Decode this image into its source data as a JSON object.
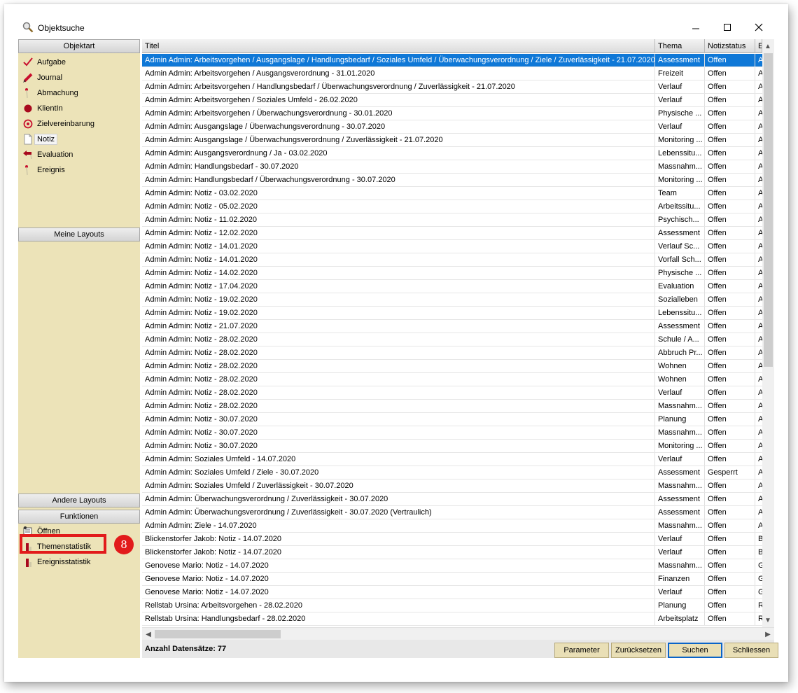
{
  "window": {
    "title": "Objektsuche"
  },
  "left_panel": {
    "objektart_header": "Objektart",
    "object_types": [
      {
        "label": "Aufgabe",
        "icon": "checkmark-icon"
      },
      {
        "label": "Journal",
        "icon": "pencil-icon"
      },
      {
        "label": "Abmachung",
        "icon": "pin-icon"
      },
      {
        "label": "KlientIn",
        "icon": "person-icon"
      },
      {
        "label": "Zielvereinbarung",
        "icon": "target-icon"
      },
      {
        "label": "Notiz",
        "icon": "note-icon"
      },
      {
        "label": "Evaluation",
        "icon": "back-arrow-icon"
      },
      {
        "label": "Ereignis",
        "icon": "pin-icon"
      }
    ],
    "meine_layouts_header": "Meine Layouts",
    "andere_layouts_header": "Andere Layouts",
    "funktionen_header": "Funktionen",
    "functions": [
      {
        "label": "Öffnen",
        "icon": "open-document-icon"
      },
      {
        "label": "Themenstatistik",
        "icon": "bar-chart-icon"
      },
      {
        "label": "Ereignisstatistik",
        "icon": "bar-chart-icon"
      }
    ],
    "callout_number": "8"
  },
  "grid": {
    "columns": [
      "Titel",
      "Thema",
      "Notizstatus",
      "E"
    ],
    "rows": [
      [
        "Admin Admin: Arbeitsvorgehen / Ausgangslage / Handlungsbedarf / Soziales Umfeld / Überwachungsverordnung / Ziele / Zuverlässigkeit - 21.07.2020",
        "Assessment",
        "Offen",
        "A"
      ],
      [
        "Admin Admin: Arbeitsvorgehen / Ausgangsverordnung - 31.01.2020",
        "Freizeit",
        "Offen",
        "A"
      ],
      [
        "Admin Admin: Arbeitsvorgehen / Handlungsbedarf / Überwachungsverordnung / Zuverlässigkeit - 21.07.2020",
        "Verlauf",
        "Offen",
        "A"
      ],
      [
        "Admin Admin: Arbeitsvorgehen / Soziales Umfeld - 26.02.2020",
        "Verlauf",
        "Offen",
        "A"
      ],
      [
        "Admin Admin: Arbeitsvorgehen / Überwachungsverordnung - 30.01.2020",
        "Physische ...",
        "Offen",
        "A"
      ],
      [
        "Admin Admin: Ausgangslage / Überwachungsverordnung - 30.07.2020",
        "Verlauf",
        "Offen",
        "A"
      ],
      [
        "Admin Admin: Ausgangslage / Überwachungsverordnung / Zuverlässigkeit - 21.07.2020",
        "Monitoring ...",
        "Offen",
        "A"
      ],
      [
        "Admin Admin: Ausgangsverordnung / Ja - 03.02.2020",
        "Lebenssitu...",
        "Offen",
        "A"
      ],
      [
        "Admin Admin: Handlungsbedarf - 30.07.2020",
        "Massnahm...",
        "Offen",
        "A"
      ],
      [
        "Admin Admin: Handlungsbedarf / Überwachungsverordnung - 30.07.2020",
        "Monitoring ...",
        "Offen",
        "A"
      ],
      [
        "Admin Admin: Notiz - 03.02.2020",
        "Team",
        "Offen",
        "A"
      ],
      [
        "Admin Admin: Notiz - 05.02.2020",
        "Arbeitssitu...",
        "Offen",
        "A"
      ],
      [
        "Admin Admin: Notiz - 11.02.2020",
        "Psychisch...",
        "Offen",
        "A"
      ],
      [
        "Admin Admin: Notiz - 12.02.2020",
        "Assessment",
        "Offen",
        "A"
      ],
      [
        "Admin Admin: Notiz - 14.01.2020",
        "Verlauf Sc...",
        "Offen",
        "A"
      ],
      [
        "Admin Admin: Notiz - 14.01.2020",
        "Vorfall Sch...",
        "Offen",
        "A"
      ],
      [
        "Admin Admin: Notiz - 14.02.2020",
        "Physische ...",
        "Offen",
        "A"
      ],
      [
        "Admin Admin: Notiz - 17.04.2020",
        "Evaluation",
        "Offen",
        "A"
      ],
      [
        "Admin Admin: Notiz - 19.02.2020",
        "Sozialleben",
        "Offen",
        "A"
      ],
      [
        "Admin Admin: Notiz - 19.02.2020",
        "Lebenssitu...",
        "Offen",
        "A"
      ],
      [
        "Admin Admin: Notiz - 21.07.2020",
        "Assessment",
        "Offen",
        "A"
      ],
      [
        "Admin Admin: Notiz - 28.02.2020",
        "Schule / A...",
        "Offen",
        "A"
      ],
      [
        "Admin Admin: Notiz - 28.02.2020",
        "Abbruch Pr...",
        "Offen",
        "A"
      ],
      [
        "Admin Admin: Notiz - 28.02.2020",
        "Wohnen",
        "Offen",
        "A"
      ],
      [
        "Admin Admin: Notiz - 28.02.2020",
        "Wohnen",
        "Offen",
        "A"
      ],
      [
        "Admin Admin: Notiz - 28.02.2020",
        "Verlauf",
        "Offen",
        "A"
      ],
      [
        "Admin Admin: Notiz - 28.02.2020",
        "Massnahm...",
        "Offen",
        "A"
      ],
      [
        "Admin Admin: Notiz - 30.07.2020",
        "Planung",
        "Offen",
        "A"
      ],
      [
        "Admin Admin: Notiz - 30.07.2020",
        "Massnahm...",
        "Offen",
        "A"
      ],
      [
        "Admin Admin: Notiz - 30.07.2020",
        "Monitoring ...",
        "Offen",
        "A"
      ],
      [
        "Admin Admin: Soziales Umfeld - 14.07.2020",
        "Verlauf",
        "Offen",
        "A"
      ],
      [
        "Admin Admin: Soziales Umfeld / Ziele - 30.07.2020",
        "Assessment",
        "Gesperrt",
        "A"
      ],
      [
        "Admin Admin: Soziales Umfeld / Zuverlässigkeit - 30.07.2020",
        "Massnahm...",
        "Offen",
        "A"
      ],
      [
        "Admin Admin: Überwachungsverordnung / Zuverlässigkeit - 30.07.2020",
        "Assessment",
        "Offen",
        "A"
      ],
      [
        "Admin Admin: Überwachungsverordnung / Zuverlässigkeit - 30.07.2020 (Vertraulich)",
        "Assessment",
        "Offen",
        "A"
      ],
      [
        "Admin Admin: Ziele - 14.07.2020",
        "Massnahm...",
        "Offen",
        "A"
      ],
      [
        "Blickenstorfer Jakob: Notiz - 14.07.2020",
        "Verlauf",
        "Offen",
        "B"
      ],
      [
        "Blickenstorfer Jakob: Notiz - 14.07.2020",
        "Verlauf",
        "Offen",
        "B"
      ],
      [
        "Genovese Mario: Notiz - 14.07.2020",
        "Massnahm...",
        "Offen",
        "G"
      ],
      [
        "Genovese Mario: Notiz - 14.07.2020",
        "Finanzen",
        "Offen",
        "G"
      ],
      [
        "Genovese Mario: Notiz - 14.07.2020",
        "Verlauf",
        "Offen",
        "G"
      ],
      [
        "Rellstab Ursina: Arbeitsvorgehen - 28.02.2020",
        "Planung",
        "Offen",
        "R"
      ],
      [
        "Rellstab Ursina: Handlungsbedarf - 28.02.2020",
        "Arbeitsplatz",
        "Offen",
        "R"
      ]
    ],
    "selected_row": 0
  },
  "footer": {
    "count_label": "Anzahl Datensätze: 77",
    "buttons": [
      "Parameter",
      "Zurücksetzen",
      "Suchen",
      "Schliessen"
    ]
  },
  "colors": {
    "selection": "#0f78d7",
    "panel": "#ece3b8",
    "button": "#e9dfb6",
    "callout": "#e21b1b"
  }
}
